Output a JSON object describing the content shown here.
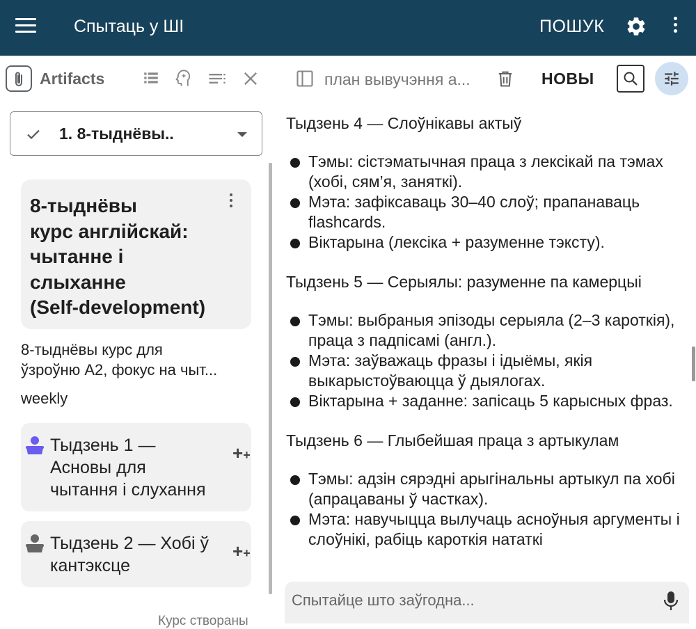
{
  "appbar": {
    "title": "Спытаць у ШІ",
    "search_label": "ПОШУК"
  },
  "toolbar": {
    "artifacts_label": "Artifacts",
    "doc_title": "план вывучэння а...",
    "new_label": "НОВЫ"
  },
  "sidebar": {
    "selected_course": "1. 8-тыднёвы..",
    "card_heading_lines": [
      "8-тыднёвы",
      "курс англійскай:",
      "чытанне і",
      "слыханне",
      "(Self-development)"
    ],
    "description_lines": [
      "8-тыднёвы курс для",
      "ўзроўню A2, фокус на чыт..."
    ],
    "frequency": "weekly",
    "weeks": [
      {
        "lines": [
          "Тыдзень 1 —",
          "Асновы для",
          "чытання і слухання"
        ]
      },
      {
        "lines": [
          "Тыдзень 2 — Хобі ў",
          "кантэксце"
        ]
      }
    ],
    "footnote": "Курс створаны"
  },
  "content": {
    "sections": [
      {
        "heading": "Тыдзень 4 — Слоўнікавы актыў",
        "items": [
          "Тэмы: сістэматычная праца з лексікай па тэмах (хобі, сям’я, заняткі).",
          "Мэта: зафіксаваць 30–40 слоў; прапанаваць flashcards.",
          "Віктарына (лексіка + разуменне тэксту)."
        ]
      },
      {
        "heading": "Тыдзень 5 — Серыялы: разуменне па камерцыі",
        "items": [
          "Тэмы: выбраныя эпізоды серыяла (2–3 кароткія), праца з падпісамі (англ.).",
          "Мэта: заўважаць фразы і ідыёмы, якія выкарыстоўваюцца ў дыялогах.",
          "Віктарына + заданне: запісаць 5 карысных фраз."
        ]
      },
      {
        "heading": "Тыдзень 6 — Глыбейшая праца з артыкулам",
        "items": [
          "Тэмы: адзін сярэдні арыгінальны артыкул па хобі (апрацаваны ў частках).",
          "Мэта: навучыцца вылучаць асноўныя аргументы і слоўнікі, рабіць кароткія нататкі"
        ]
      }
    ]
  },
  "chat": {
    "placeholder": "Спытайце што заўгодна..."
  },
  "colors": {
    "appbar": "#17425b",
    "accent": "#cfe0f3",
    "card": "#f1f1f1",
    "avatar_active": "#6a5cf0"
  },
  "icons": [
    "menu-icon",
    "gear-icon",
    "more-vert-icon",
    "paperclip-icon",
    "list-icon",
    "brain-icon",
    "playlist-icon",
    "close-icon",
    "sidebar-icon",
    "trash-icon",
    "search-icon",
    "tune-icon",
    "check-icon",
    "dropdown-arrow-icon",
    "avatar-icon",
    "add-icon",
    "mic-icon"
  ]
}
